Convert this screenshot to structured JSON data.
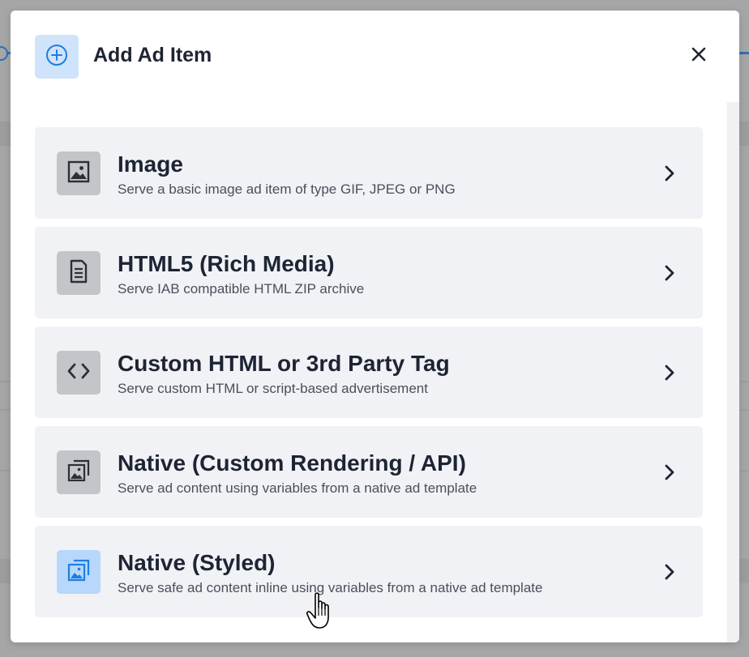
{
  "dialog": {
    "title": "Add Ad Item",
    "icon": "plus-circle-icon",
    "close_icon": "close-icon"
  },
  "colors": {
    "accent": "#1e7ee0",
    "accent_light": "#cfe3fb",
    "item_bg": "#f1f2f6",
    "icon_bg": "#c4c5c8",
    "text_dark": "#1d2433"
  },
  "items": [
    {
      "title": "Image",
      "description": "Serve a basic image ad item of type GIF, JPEG or PNG",
      "icon": "image-icon"
    },
    {
      "title": "HTML5 (Rich Media)",
      "description": "Serve IAB compatible HTML ZIP archive",
      "icon": "document-icon"
    },
    {
      "title": "Custom HTML or 3rd Party Tag",
      "description": "Serve custom HTML or script-based advertisement",
      "icon": "code-icon"
    },
    {
      "title": "Native (Custom Rendering / API)",
      "description": "Serve ad content using variables from a native ad template",
      "icon": "native-template-icon"
    },
    {
      "title": "Native (Styled)",
      "description": "Serve safe ad content inline using variables from a native ad template",
      "icon": "native-template-icon",
      "hovered": true
    }
  ]
}
